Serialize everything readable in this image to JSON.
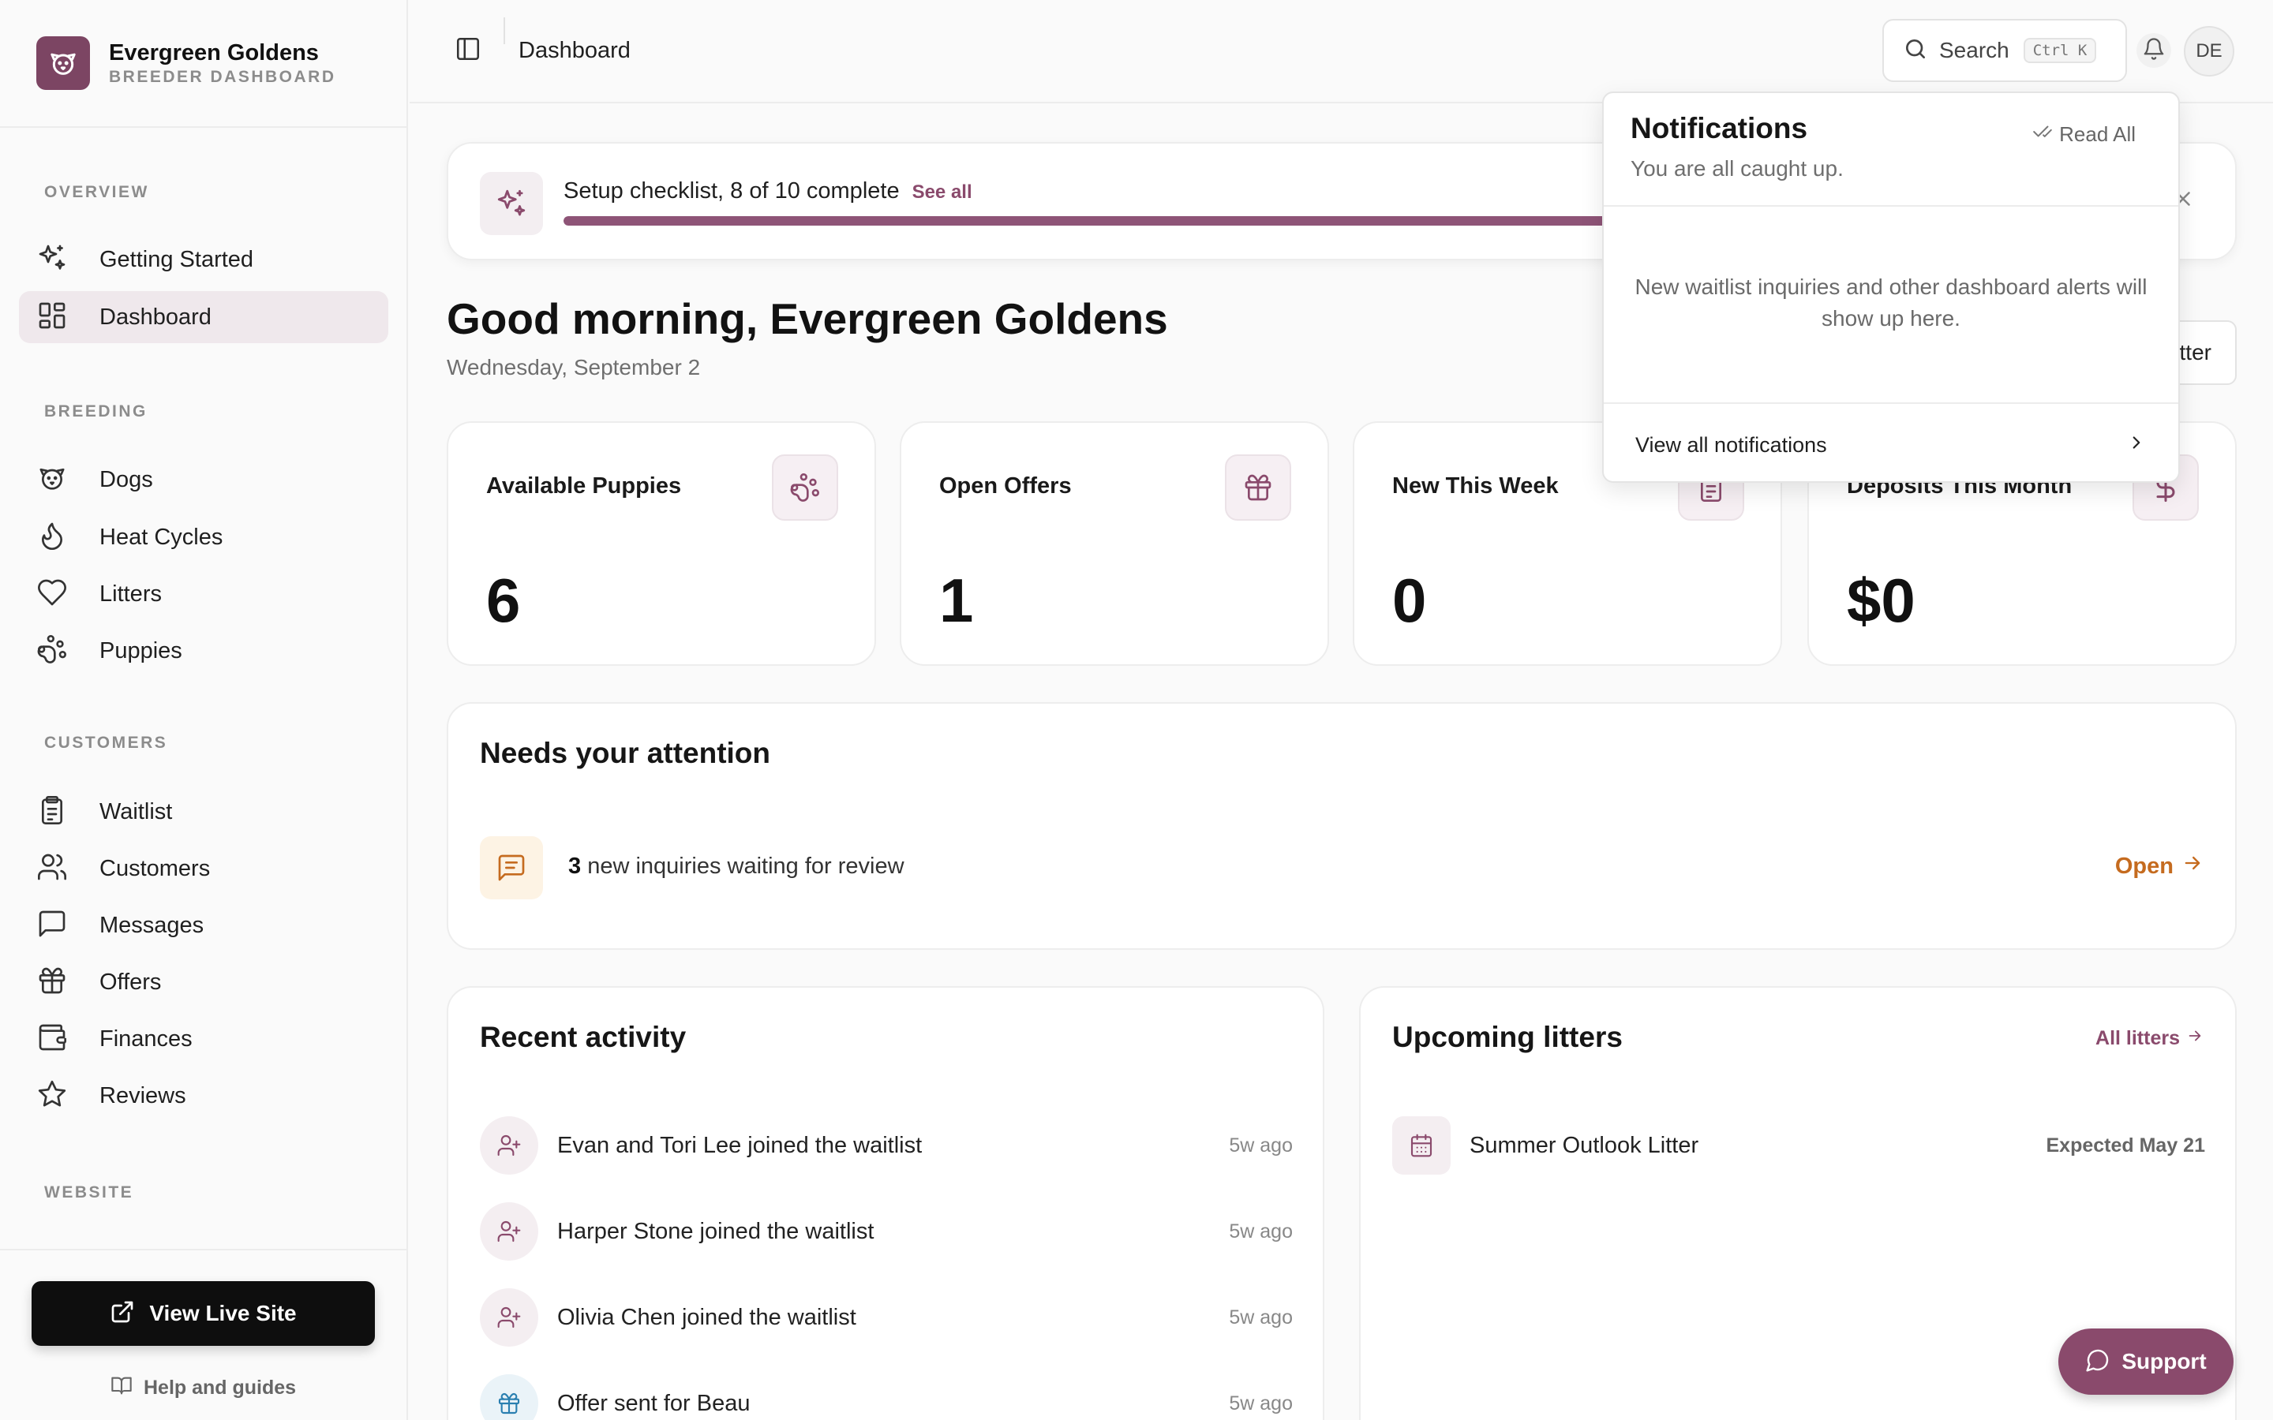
{
  "brand": {
    "name": "Evergreen Goldens",
    "subtitle": "BREEDER DASHBOARD"
  },
  "nav": {
    "sections": [
      {
        "title": "OVERVIEW",
        "items": [
          {
            "label": "Getting Started",
            "icon": "sparkles-icon"
          },
          {
            "label": "Dashboard",
            "icon": "dashboard-grid-icon",
            "active": true
          }
        ]
      },
      {
        "title": "BREEDING",
        "items": [
          {
            "label": "Dogs",
            "icon": "dog-face-icon"
          },
          {
            "label": "Heat Cycles",
            "icon": "flame-icon"
          },
          {
            "label": "Litters",
            "icon": "heart-icon"
          },
          {
            "label": "Puppies",
            "icon": "paw-icon"
          }
        ]
      },
      {
        "title": "CUSTOMERS",
        "items": [
          {
            "label": "Waitlist",
            "icon": "clipboard-list-icon"
          },
          {
            "label": "Customers",
            "icon": "users-icon"
          },
          {
            "label": "Messages",
            "icon": "message-square-icon"
          },
          {
            "label": "Offers",
            "icon": "gift-icon"
          },
          {
            "label": "Finances",
            "icon": "wallet-icon"
          },
          {
            "label": "Reviews",
            "icon": "star-icon"
          }
        ]
      },
      {
        "title": "WEBSITE",
        "items": []
      }
    ]
  },
  "sidebar_footer": {
    "live_site": "View Live Site",
    "help": "Help and guides"
  },
  "topbar": {
    "breadcrumb": "Dashboard",
    "search_placeholder": "Search",
    "search_shortcut": "Ctrl K",
    "avatar_initials": "DE"
  },
  "setup": {
    "text": "Setup checklist, 8 of 10 complete",
    "see_all": "See all",
    "completed": 8,
    "total": 10
  },
  "greeting": {
    "title": "Good morning, Evergreen Goldens",
    "date": "Wednesday, September 2",
    "action_partial": "tter"
  },
  "stats": [
    {
      "label": "Available Puppies",
      "value": "6",
      "icon": "paw-icon"
    },
    {
      "label": "Open Offers",
      "value": "1",
      "icon": "gift-icon"
    },
    {
      "label": "New This Week",
      "value": "0",
      "icon": "clipboard-list-icon"
    },
    {
      "label": "Deposits This Month",
      "value": "$0",
      "icon": "dollar-icon"
    }
  ],
  "attention": {
    "title": "Needs your attention",
    "count": "3",
    "text": " new inquiries waiting for review",
    "action": "Open"
  },
  "activity": {
    "title": "Recent activity",
    "items": [
      {
        "text": "Evan and Tori Lee joined the waitlist",
        "ago": "5w ago",
        "icon": "user-plus-icon"
      },
      {
        "text": "Harper Stone joined the waitlist",
        "ago": "5w ago",
        "icon": "user-plus-icon"
      },
      {
        "text": "Olivia Chen joined the waitlist",
        "ago": "5w ago",
        "icon": "user-plus-icon"
      },
      {
        "text": "Offer sent for Beau",
        "ago": "5w ago",
        "icon": "gift-icon"
      }
    ]
  },
  "litters": {
    "title": "Upcoming litters",
    "all_link": "All litters",
    "items": [
      {
        "name": "Summer Outlook Litter",
        "expected": "Expected May 21"
      }
    ]
  },
  "support": {
    "label": "Support"
  },
  "notifications": {
    "title": "Notifications",
    "read_all": "Read All",
    "subtitle": "You are all caught up.",
    "empty": "New waitlist inquiries and other dashboard alerts will show up here.",
    "view_all": "View all notifications"
  },
  "colors": {
    "accent": "#8a4a6c",
    "progress": "#8e5477",
    "attention_orange": "#c56b1f",
    "sidebar_active": "#efe8ec"
  }
}
